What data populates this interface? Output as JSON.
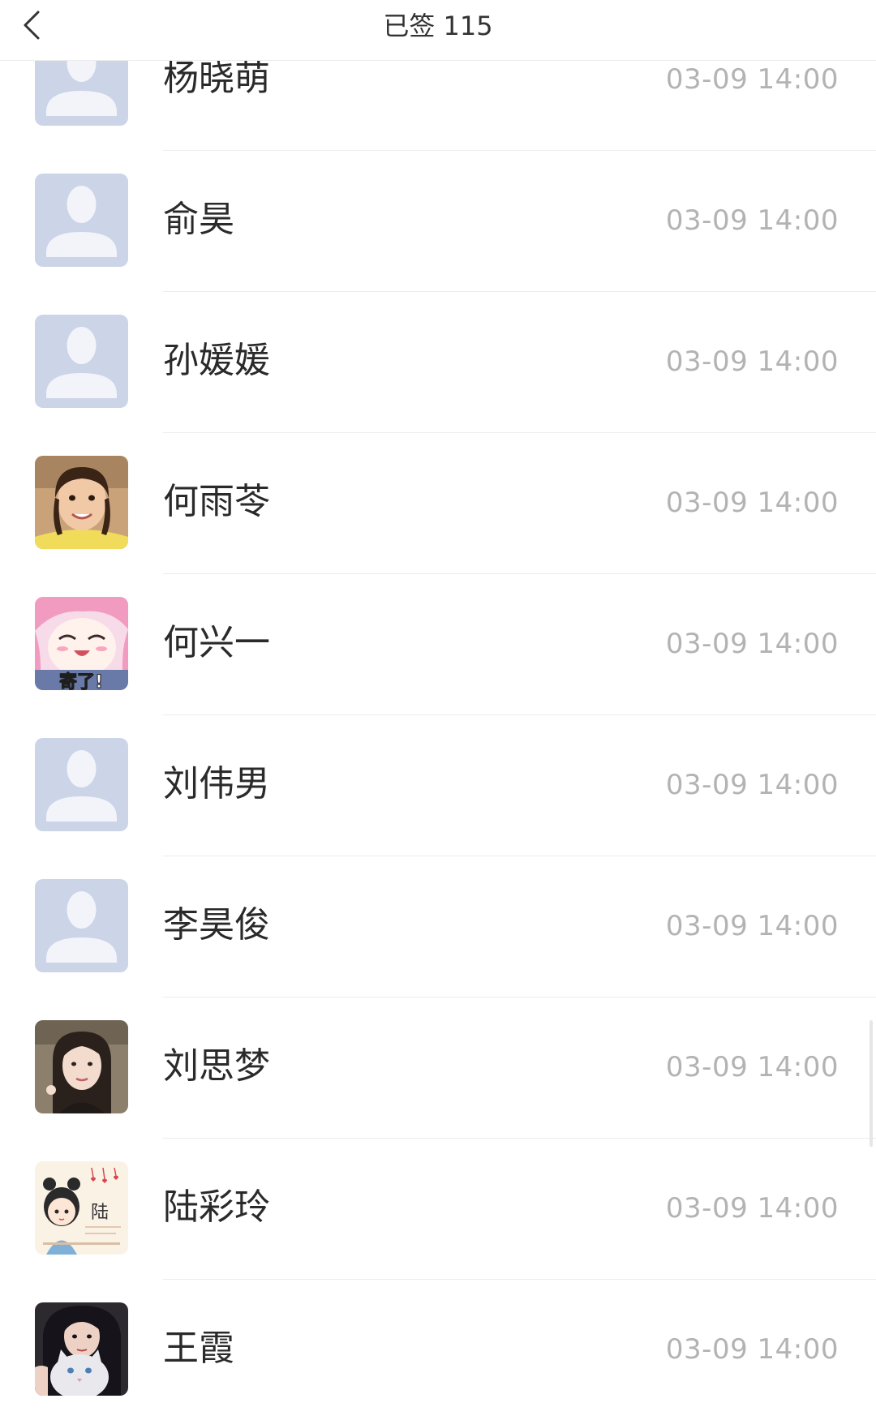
{
  "header": {
    "back_icon": "chevron-left-icon",
    "title": "已签 115"
  },
  "list": {
    "items": [
      {
        "name": "杨晓萌",
        "time": "03-09 14:00",
        "avatar": "default-person-icon"
      },
      {
        "name": "俞昊",
        "time": "03-09 14:00",
        "avatar": "default-person-icon"
      },
      {
        "name": "孙媛媛",
        "time": "03-09 14:00",
        "avatar": "default-person-icon"
      },
      {
        "name": "何雨苓",
        "time": "03-09 14:00",
        "avatar": "child-photo"
      },
      {
        "name": "何兴一",
        "time": "03-09 14:00",
        "avatar": "anime-pink-hair-sticker",
        "avatar_caption": "寄了!"
      },
      {
        "name": "刘伟男",
        "time": "03-09 14:00",
        "avatar": "default-person-icon"
      },
      {
        "name": "李昊俊",
        "time": "03-09 14:00",
        "avatar": "default-person-icon"
      },
      {
        "name": "刘思梦",
        "time": "03-09 14:00",
        "avatar": "woman-selfie-photo"
      },
      {
        "name": "陆彩玲",
        "time": "03-09 14:00",
        "avatar": "cartoon-girl-illustration",
        "avatar_caption": "陆"
      },
      {
        "name": "王霞",
        "time": "03-09 14:00",
        "avatar": "woman-with-cat-photo"
      }
    ]
  },
  "colors": {
    "placeholder_bg": "#ccd4e8",
    "placeholder_figure": "#f2f4fa",
    "name_text": "#2a2a2a",
    "time_text": "#b3b3b3",
    "divider": "#ececec"
  }
}
